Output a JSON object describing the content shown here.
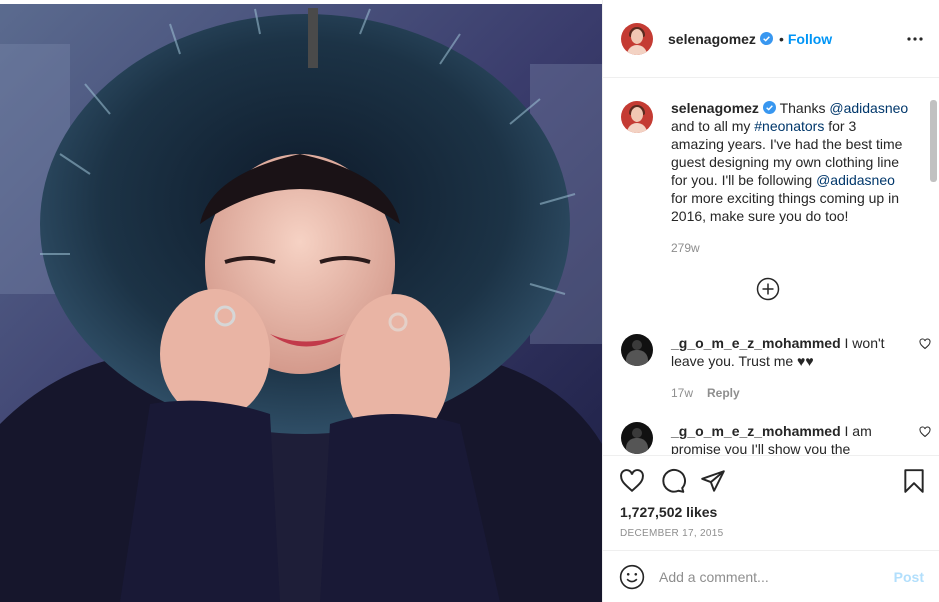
{
  "header": {
    "username": "selenagomez",
    "dot": "•",
    "follow_label": "Follow",
    "more_icon": "more-options-icon"
  },
  "caption": {
    "username": "selenagomez",
    "parts": {
      "t1": " Thanks ",
      "m1": "@adidasneo",
      "t2": " and to all my ",
      "h1": "#neonators",
      "t3": " for 3 amazing years. I've had the best time guest designing my own clothing line for you. I'll be following ",
      "m2": "@adidasneo",
      "t4": " for more exciting things coming up in 2016, make sure you do too!"
    },
    "age": "279w"
  },
  "comments": [
    {
      "username": "_g_o_m_e_z_mohammed",
      "text": " I won't leave you. Trust me ♥♥",
      "age": "17w",
      "reply": "Reply"
    },
    {
      "username": "_g_o_m_e_z_mohammed",
      "text": " I am promise you I'll show you the",
      "age": "",
      "reply": ""
    }
  ],
  "actions": {
    "likes": "1,727,502 likes",
    "date": "DECEMBER 17, 2015"
  },
  "composer": {
    "placeholder": "Add a comment...",
    "post_label": "Post"
  },
  "colors": {
    "accent": "#0095f6",
    "link": "#00376b",
    "muted": "#8e8e8e",
    "post_disabled": "#b2dffc"
  }
}
